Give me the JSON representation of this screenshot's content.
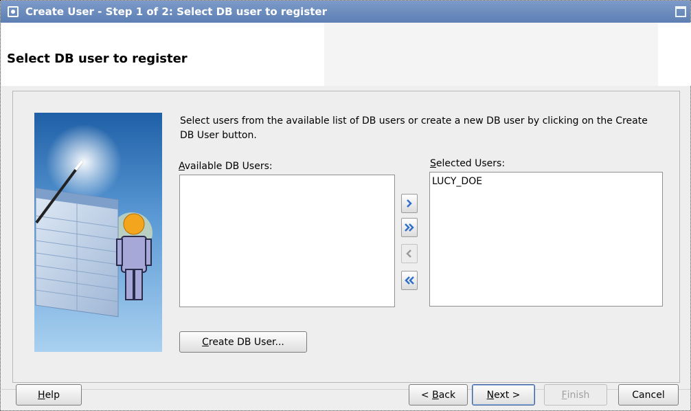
{
  "window": {
    "title": "Create User - Step 1 of 2: Select DB user to register"
  },
  "header": {
    "heading": "Select DB user to register"
  },
  "main": {
    "instruction": "Select users from the available list of DB users or create a new DB user by clicking on the Create DB User button.",
    "available": {
      "label_mnemonic": "A",
      "label_rest": "vailable DB Users:",
      "items": []
    },
    "selected": {
      "label_mnemonic": "S",
      "label_rest": "elected Users:",
      "items": [
        "LUCY_DOE"
      ]
    },
    "shuttle": {
      "move": "move-right-icon",
      "move_all": "move-all-right-icon",
      "remove": "move-left-icon",
      "remove_all": "move-all-left-icon"
    },
    "create_db_user": {
      "mnemonic": "C",
      "rest": "reate DB User..."
    }
  },
  "footer": {
    "help": {
      "mnemonic": "H",
      "rest": "elp"
    },
    "back": {
      "prefix": "< ",
      "mnemonic": "B",
      "rest": "ack"
    },
    "next": {
      "mnemonic": "N",
      "rest": "ext >"
    },
    "finish": {
      "mnemonic": "F",
      "rest": "inish"
    },
    "cancel": {
      "label": "Cancel"
    }
  },
  "colors": {
    "titlebar": "#6b8cc0",
    "shuttle_arrow": "#2f6fc6"
  }
}
